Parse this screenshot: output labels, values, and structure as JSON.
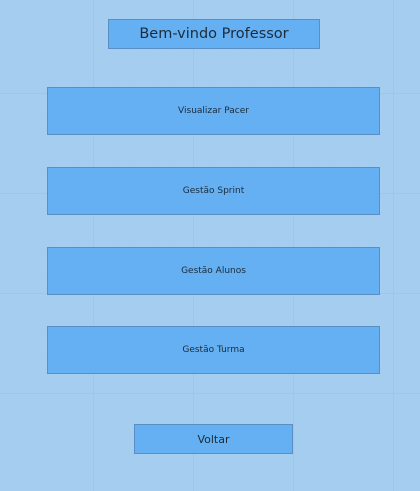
{
  "header": {
    "title": "Bem-vindo Professor"
  },
  "menu": {
    "items": [
      {
        "label": "Visualizar Pacer"
      },
      {
        "label": "Gestão Sprint"
      },
      {
        "label": "Gestão Alunos"
      },
      {
        "label": "Gestão Turma"
      }
    ]
  },
  "footer": {
    "back_label": "Voltar"
  },
  "colors": {
    "background": "#a5cdef",
    "button_fill": "#64b0f2",
    "button_border": "#5b8fc4",
    "text": "#1d2b3a"
  }
}
